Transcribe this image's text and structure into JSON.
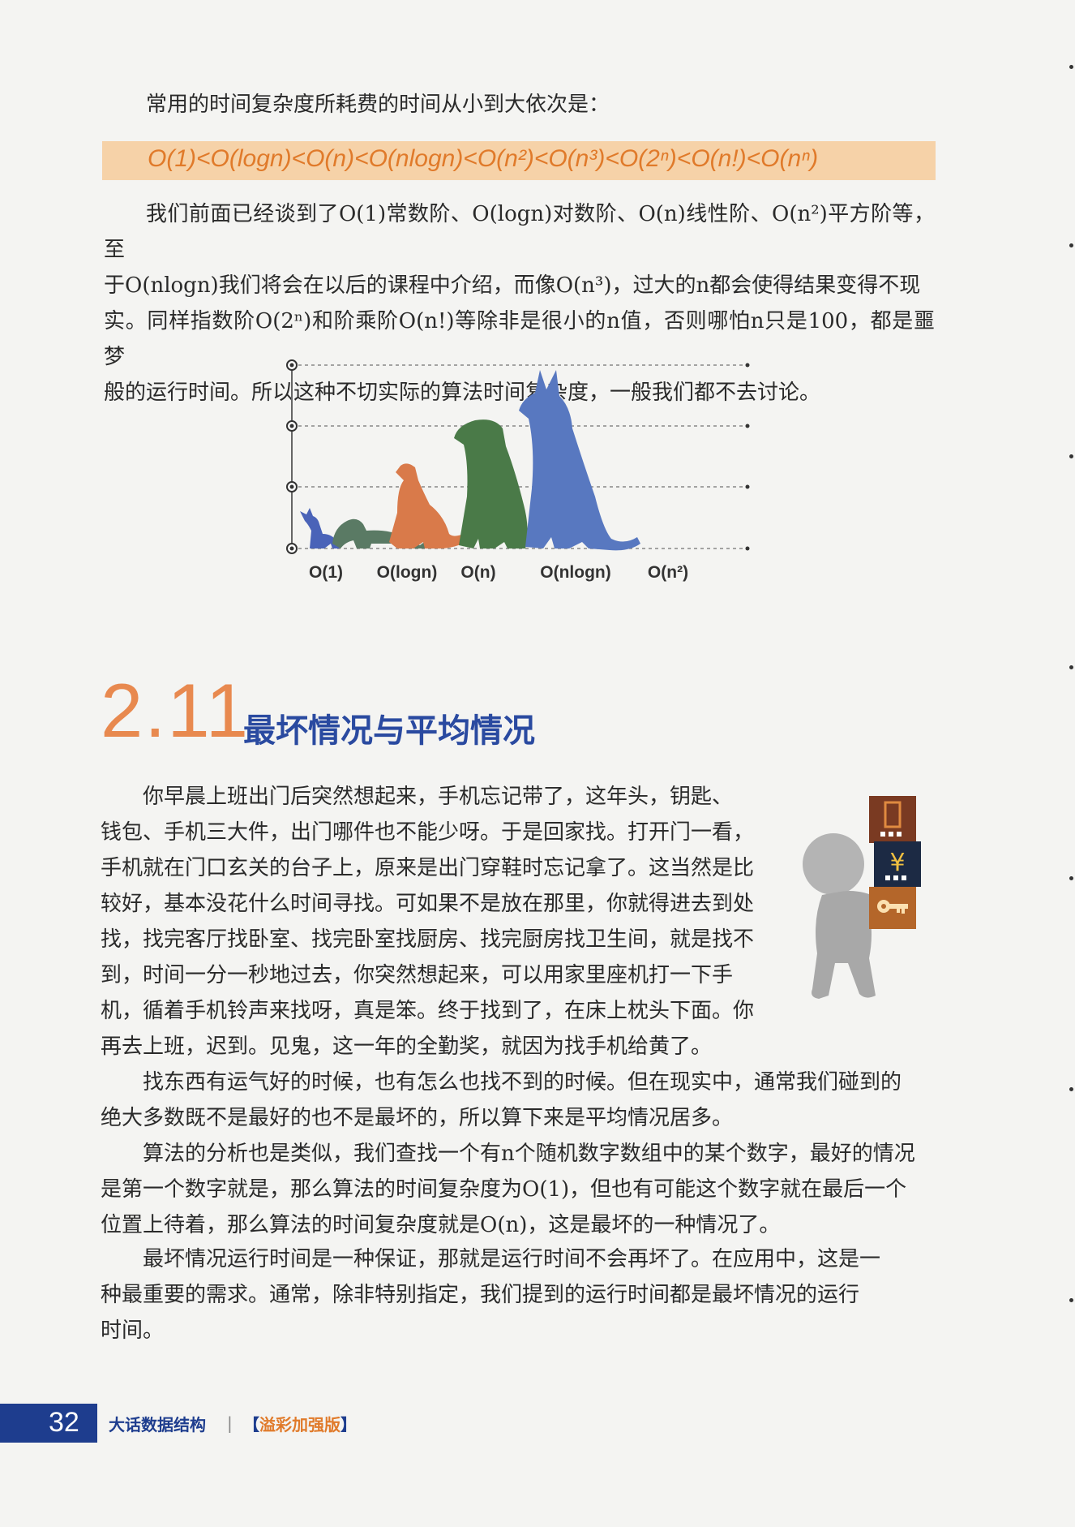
{
  "intro": "常用的时间复杂度所耗费的时间从小到大依次是：",
  "formula": "O(1)<O(logn)<O(n)<O(nlogn)<O(n²)<O(n³)<O(2ⁿ)<O(n!)<O(nⁿ)",
  "para1": [
    "我们前面已经谈到了O(1)常数阶、O(logn)对数阶、O(n)线性阶、O(n²)平方阶等，至",
    "于O(nlogn)我们将会在以后的课程中介绍，而像O(n³)，过大的n都会使得结果变得不现",
    "实。同样指数阶O(2ⁿ)和阶乘阶O(n!)等除非是很小的n值，否则哪怕n只是100，都是噩梦",
    "般的运行时间。所以这种不切实际的算法时间复杂度，一般我们都不去讨论。"
  ],
  "figure": {
    "labels": [
      "O(1)",
      "O(logn)",
      "O(n)",
      "O(nlogn)",
      "O(n²)"
    ],
    "colors": [
      "#4a63b8",
      "#5a7a64",
      "#d97a4a",
      "#4a7a48",
      "#5878c0"
    ]
  },
  "section": {
    "number": "2.11",
    "title": "最坏情况与平均情况"
  },
  "para2": [
    "你早晨上班出门后突然想起来，手机忘记带了，这年头，钥匙、",
    "钱包、手机三大件，出门哪件也不能少呀。于是回家找。打开门一看，",
    "手机就在门口玄关的台子上，原来是出门穿鞋时忘记拿了。这当然是比",
    "较好，基本没花什么时间寻找。可如果不是放在那里，你就得进去到处",
    "找，找完客厅找卧室、找完卧室找厨房、找完厨房找卫生间，就是找不",
    "到，时间一分一秒地过去，你突然想起来，可以用家里座机打一下手",
    "机，循着手机铃声来找呀，真是笨。终于找到了，在床上枕头下面。你",
    "再去上班，迟到。见鬼，这一年的全勤奖，就因为找手机给黄了。"
  ],
  "para3": [
    "找东西有运气好的时候，也有怎么也找不到的时候。但在现实中，通常我们碰到的",
    "绝大多数既不是最好的也不是最坏的，所以算下来是平均情况居多。"
  ],
  "para4": [
    "算法的分析也是类似，我们查找一个有n个随机数字数组中的某个数字，最好的情况",
    "是第一个数字就是，那么算法的时间复杂度为O(1)，但也有可能这个数字就在最后一个",
    "位置上待着，那么算法的时间复杂度就是O(n)，这是最坏的一种情况了。"
  ],
  "para5": [
    "最坏情况运行时间是一种保证，那就是运行时间不会再坏了。在应用中，这是一",
    "种最重要的需求。通常，除非特别指定，我们提到的运行时间都是最坏情况的运行",
    "时间。"
  ],
  "illustration": {
    "yen": "¥"
  },
  "footer": {
    "page": "32",
    "book": "大话数据结构",
    "sep": "|",
    "edition_open": "【",
    "edition": "溢彩加强版",
    "edition_close": "】"
  }
}
